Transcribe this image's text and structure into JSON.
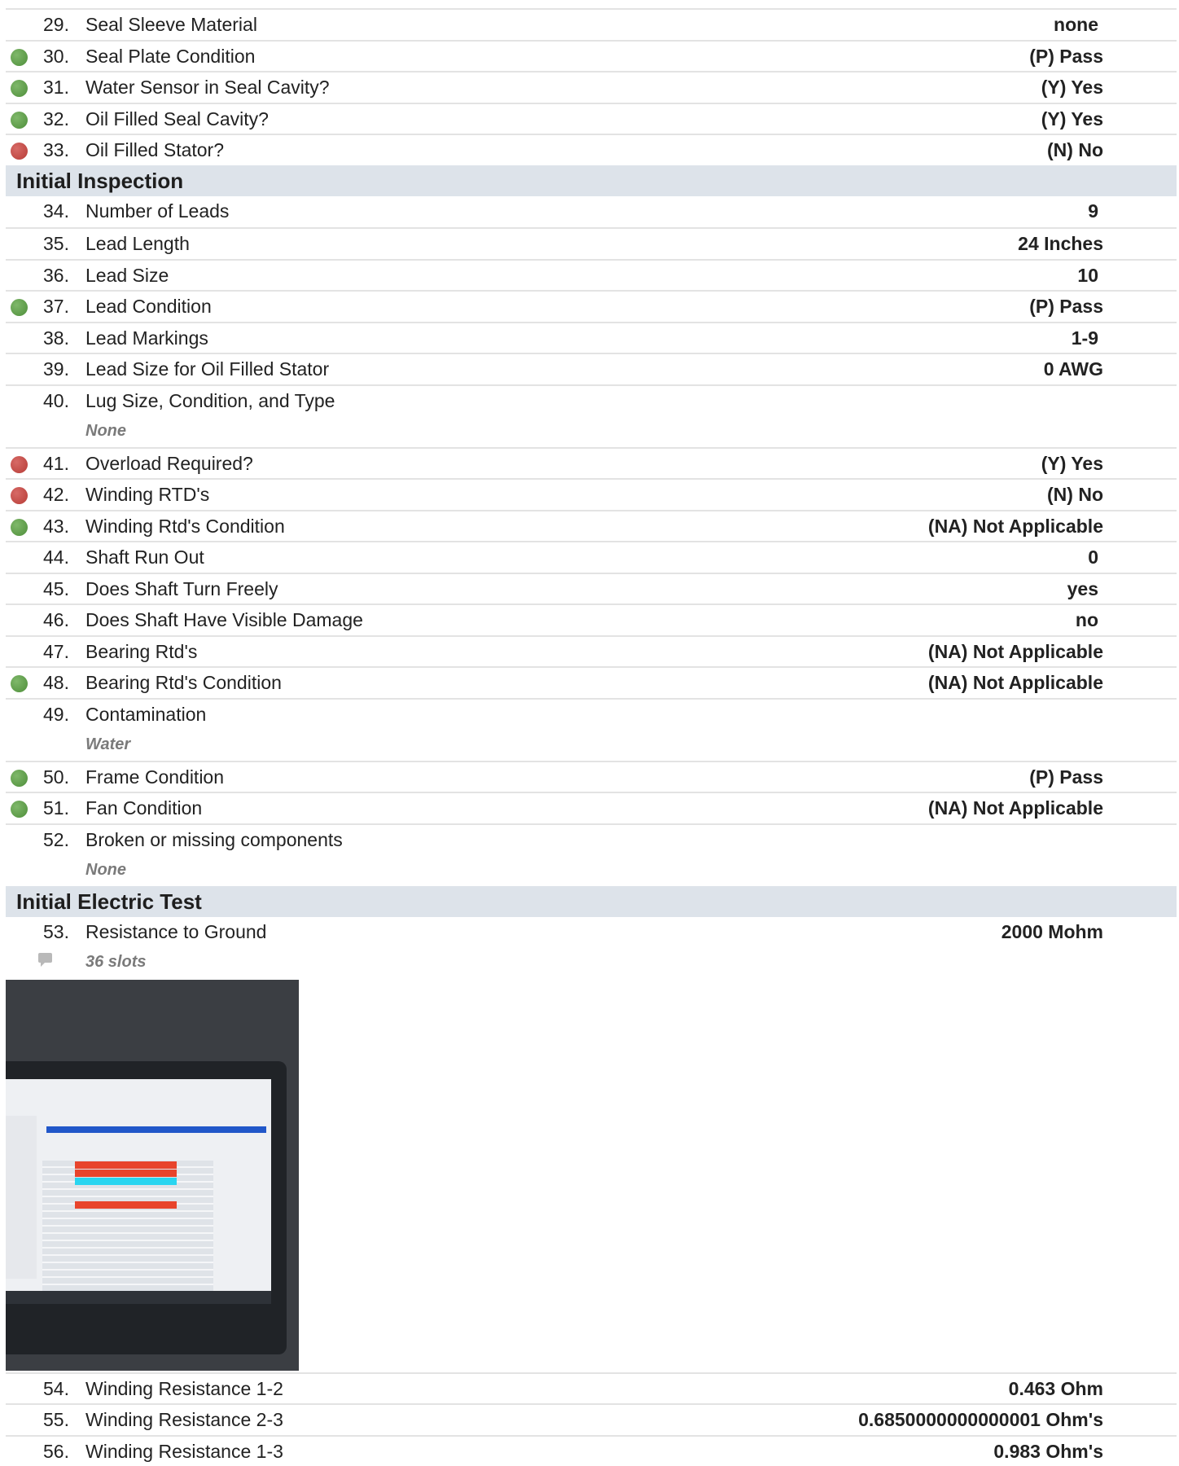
{
  "sections": {
    "initial_inspection": "Initial Inspection",
    "initial_electric_test": "Initial Electric Test"
  },
  "items": {
    "i29": {
      "num": "29.",
      "label": "Seal Sleeve Material",
      "value": "none",
      "status": "none"
    },
    "i30": {
      "num": "30.",
      "label": "Seal Plate Condition",
      "value": "(P) Pass",
      "status": "green"
    },
    "i31": {
      "num": "31.",
      "label": "Water Sensor in Seal Cavity?",
      "value": "(Y) Yes",
      "status": "green"
    },
    "i32": {
      "num": "32.",
      "label": "Oil Filled Seal Cavity?",
      "value": "(Y) Yes",
      "status": "green"
    },
    "i33": {
      "num": "33.",
      "label": "Oil Filled Stator?",
      "value": "(N) No",
      "status": "red"
    },
    "i34": {
      "num": "34.",
      "label": "Number of Leads",
      "value": "9",
      "status": "none"
    },
    "i35": {
      "num": "35.",
      "label": "Lead Length",
      "value": "24 Inches",
      "status": "none"
    },
    "i36": {
      "num": "36.",
      "label": "Lead Size",
      "value": "10",
      "status": "none"
    },
    "i37": {
      "num": "37.",
      "label": "Lead Condition",
      "value": "(P) Pass",
      "status": "green"
    },
    "i38": {
      "num": "38.",
      "label": "Lead Markings",
      "value": "1-9",
      "status": "none"
    },
    "i39": {
      "num": "39.",
      "label": "Lead Size for Oil Filled Stator",
      "value": "0 AWG",
      "status": "none"
    },
    "i40": {
      "num": "40.",
      "label": "Lug Size, Condition, and Type",
      "note": "None",
      "status": "none"
    },
    "i41": {
      "num": "41.",
      "label": "Overload Required?",
      "value": "(Y) Yes",
      "status": "red"
    },
    "i42": {
      "num": "42.",
      "label": "Winding RTD's",
      "value": "(N) No",
      "status": "red"
    },
    "i43": {
      "num": "43.",
      "label": "Winding Rtd's Condition",
      "value": "(NA) Not Applicable",
      "status": "green"
    },
    "i44": {
      "num": "44.",
      "label": "Shaft Run Out",
      "value": "0",
      "status": "none"
    },
    "i45": {
      "num": "45.",
      "label": "Does Shaft Turn Freely",
      "value": "yes",
      "status": "none"
    },
    "i46": {
      "num": "46.",
      "label": "Does Shaft Have Visible Damage",
      "value": "no",
      "status": "none"
    },
    "i47": {
      "num": "47.",
      "label": "Bearing Rtd's",
      "value": "(NA) Not Applicable",
      "status": "none"
    },
    "i48": {
      "num": "48.",
      "label": "Bearing Rtd's Condition",
      "value": "(NA) Not Applicable",
      "status": "green"
    },
    "i49": {
      "num": "49.",
      "label": "Contamination",
      "note": "Water",
      "status": "none"
    },
    "i50": {
      "num": "50.",
      "label": "Frame Condition",
      "value": "(P) Pass",
      "status": "green"
    },
    "i51": {
      "num": "51.",
      "label": "Fan Condition",
      "value": "(NA) Not Applicable",
      "status": "green"
    },
    "i52": {
      "num": "52.",
      "label": "Broken or missing components",
      "note": "None",
      "status": "none"
    },
    "i53": {
      "num": "53.",
      "label": "Resistance to Ground",
      "value": "2000 Mohm",
      "comment": "36 slots",
      "status": "none"
    },
    "i54": {
      "num": "54.",
      "label": "Winding Resistance 1-2",
      "value": "0.463 Ohm",
      "status": "none"
    },
    "i55": {
      "num": "55.",
      "label": "Winding Resistance 2-3",
      "value": "0.6850000000000001 Ohm's",
      "status": "none"
    },
    "i56": {
      "num": "56.",
      "label": "Winding Resistance 1-3",
      "value": "0.983 Ohm's",
      "status": "none"
    }
  },
  "colors": {
    "pass_green": "#5a9a45",
    "fail_red": "#c0443f",
    "section_bg": "#dde3ea"
  },
  "photo": {
    "description_icon": "camera-photo-of-test-screen"
  }
}
